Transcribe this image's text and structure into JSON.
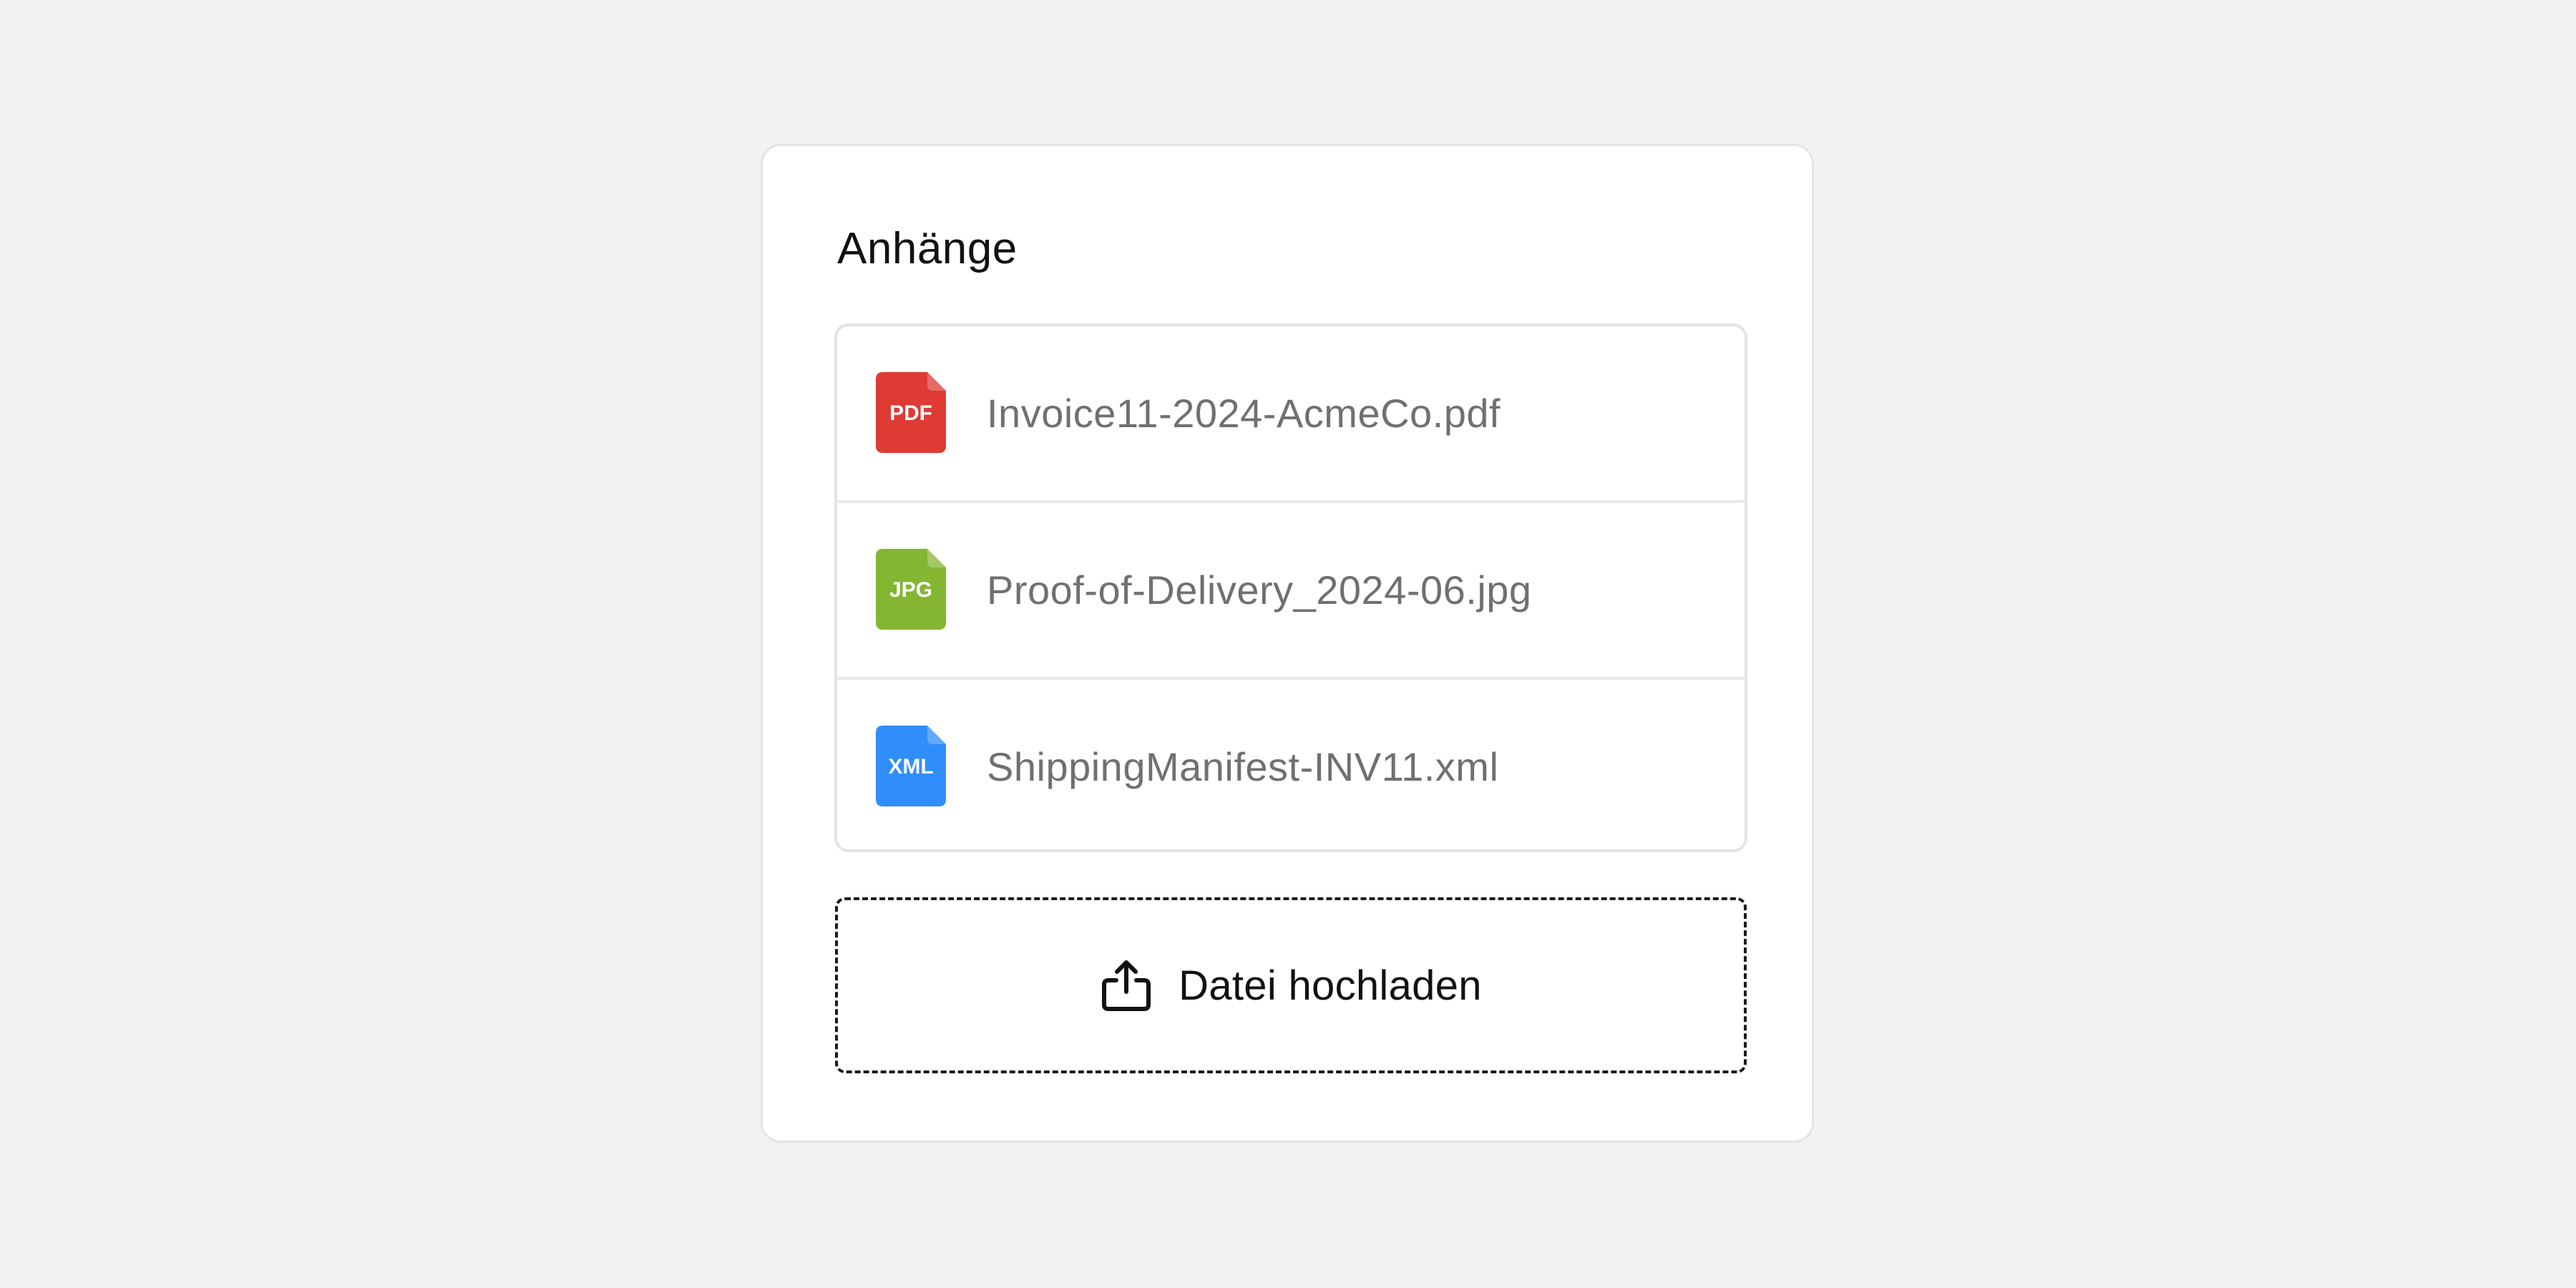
{
  "card": {
    "title": "Anhänge"
  },
  "attachments": [
    {
      "type_label": "PDF",
      "icon": "pdf-file-icon",
      "color": "#de3b35",
      "filename": "Invoice11-2024-AcmeCo.pdf"
    },
    {
      "type_label": "JPG",
      "icon": "jpg-file-icon",
      "color": "#84b631",
      "filename": "Proof-of-Delivery_2024-06.jpg"
    },
    {
      "type_label": "XML",
      "icon": "xml-file-icon",
      "color": "#2f8efc",
      "filename": "ShippingManifest-INV11.xml"
    }
  ],
  "upload": {
    "label": "Datei hochladen",
    "icon": "upload-icon"
  }
}
